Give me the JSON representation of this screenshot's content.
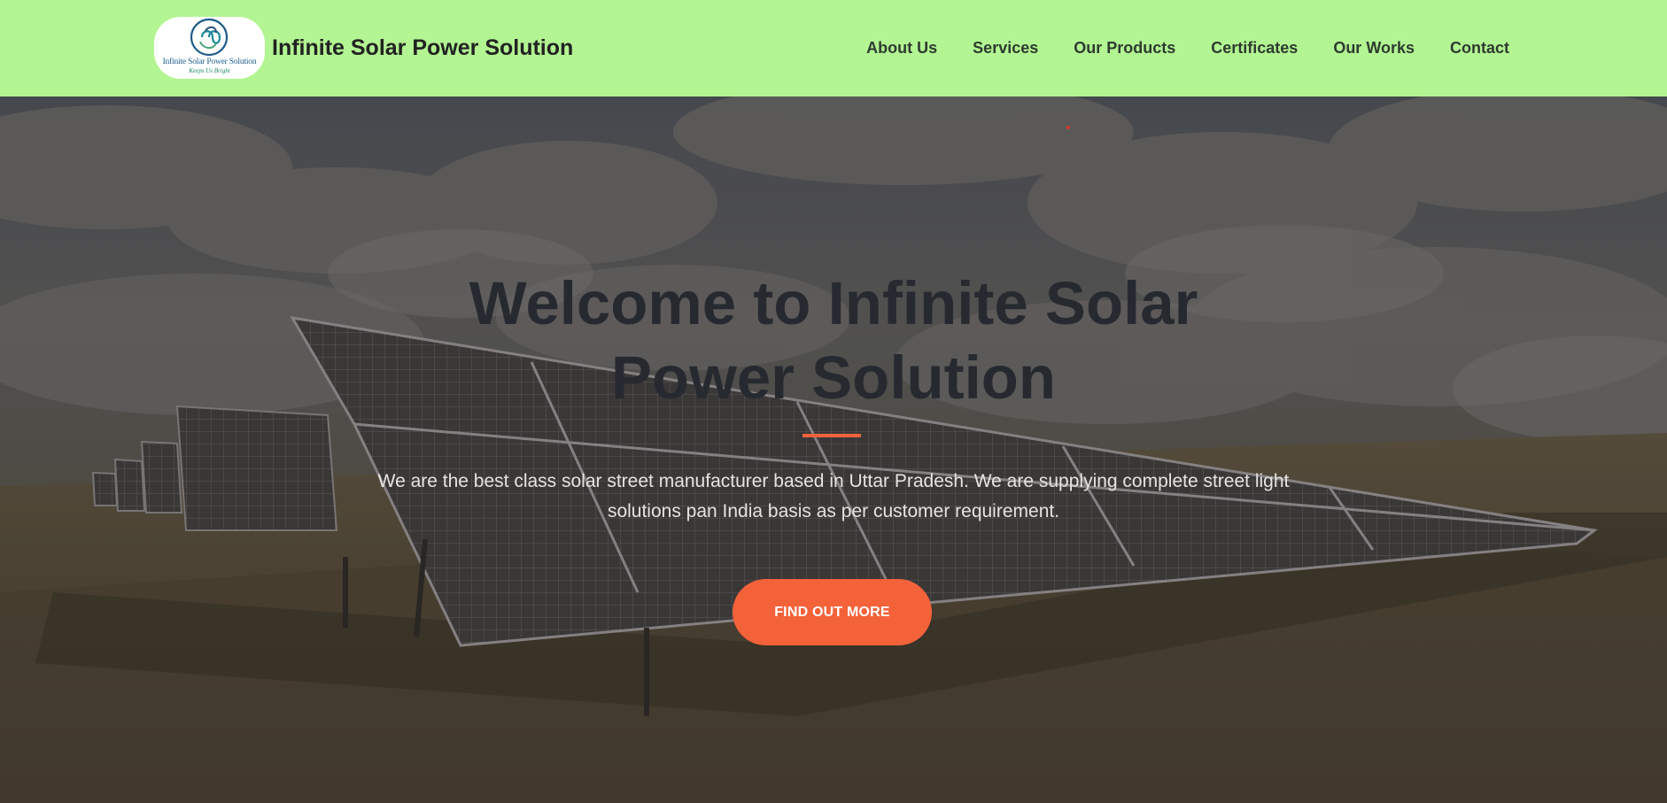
{
  "navbar": {
    "brand_name": "Infinite Solar Power Solution",
    "logo_text": "Infinite Solar Power Solution",
    "logo_tagline": "Keeps Us Bright",
    "links": [
      "About Us",
      "Services",
      "Our Products",
      "Certificates",
      "Our Works",
      "Contact"
    ],
    "background_color": "#b2f592"
  },
  "hero": {
    "title_line1": "Welcome to Infinite Solar",
    "title_line2": "Power Solution",
    "description": "We are the best class solar street manufacturer based in Uttar Pradesh. We are supplying complete street light solutions pan India basis as per customer requirement.",
    "cta_label": "FIND OUT MORE",
    "accent_color": "#f4623a"
  },
  "icons": {
    "logo": "infinity-loop-logo-icon",
    "background": "solar-panels-field-image"
  }
}
